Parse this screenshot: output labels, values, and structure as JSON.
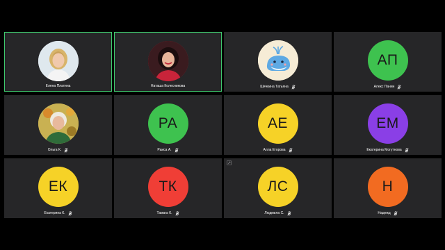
{
  "participants": [
    {
      "name": "Елена Платина",
      "initials": "",
      "avatar_type": "photo-blonde-woman",
      "avatar_color": "#d9e4ea",
      "speaking": true,
      "muted": false,
      "pinned": false
    },
    {
      "name": "Наташа Колесникова",
      "initials": "",
      "avatar_type": "photo-darkhair-woman",
      "avatar_color": "#b9283a",
      "speaking": true,
      "muted": false,
      "pinned": false
    },
    {
      "name": "Шичкина Татьяна",
      "initials": "",
      "avatar_type": "whale-illustration",
      "avatar_color": "#f6e8c8",
      "speaking": false,
      "muted": true,
      "pinned": false
    },
    {
      "name": "Алекс Панин",
      "initials": "АП",
      "avatar_type": "initials",
      "avatar_color": "#3ec24f",
      "speaking": false,
      "muted": true,
      "pinned": false
    },
    {
      "name": "Ольга К.",
      "initials": "",
      "avatar_type": "photo-older-woman",
      "avatar_color": "#c8a14a",
      "speaking": false,
      "muted": true,
      "pinned": false
    },
    {
      "name": "Раиса А.",
      "initials": "РА",
      "avatar_type": "initials",
      "avatar_color": "#3ec24f",
      "speaking": false,
      "muted": true,
      "pinned": false
    },
    {
      "name": "Алла Егорова",
      "initials": "АЕ",
      "avatar_type": "initials",
      "avatar_color": "#f6d227",
      "speaking": false,
      "muted": true,
      "pinned": false
    },
    {
      "name": "Екатерина Могутнова",
      "initials": "ЕМ",
      "avatar_type": "initials",
      "avatar_color": "#8a3fe6",
      "speaking": false,
      "muted": true,
      "pinned": false
    },
    {
      "name": "Екатерина К.",
      "initials": "ЕК",
      "avatar_type": "initials",
      "avatar_color": "#f6d227",
      "speaking": false,
      "muted": true,
      "pinned": false
    },
    {
      "name": "Тамага К.",
      "initials": "ТК",
      "avatar_type": "initials",
      "avatar_color": "#f03e36",
      "speaking": false,
      "muted": true,
      "pinned": false
    },
    {
      "name": "Людмила С.",
      "initials": "ЛС",
      "avatar_type": "initials",
      "avatar_color": "#f6d227",
      "speaking": false,
      "muted": true,
      "pinned": true
    },
    {
      "name": "Надежд",
      "initials": "Н",
      "avatar_type": "initials",
      "avatar_color": "#f26b21",
      "speaking": false,
      "muted": true,
      "pinned": false
    }
  ],
  "colors": {
    "background": "#000000",
    "tile": "#262628",
    "speaking_border": "#3fca6e",
    "text": "#ffffff"
  },
  "icons": {
    "mic_off": "mic-off-icon",
    "pin": "pin-icon"
  }
}
